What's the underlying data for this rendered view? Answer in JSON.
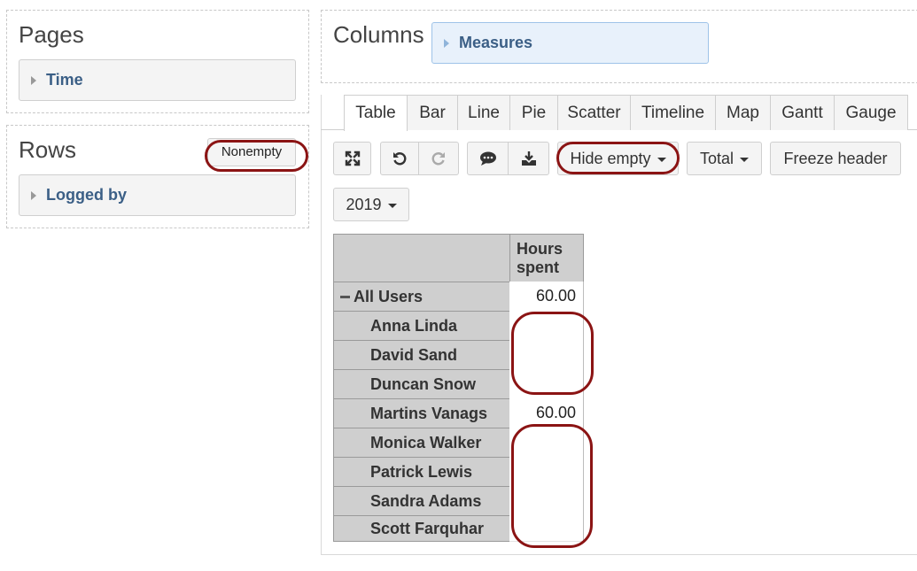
{
  "pages": {
    "title": "Pages",
    "dimension": "Time"
  },
  "rows": {
    "title": "Rows",
    "nonempty_label": "Nonempty",
    "dimension": "Logged by"
  },
  "columns": {
    "title": "Columns",
    "dimension": "Measures"
  },
  "tabs": [
    "Table",
    "Bar",
    "Line",
    "Pie",
    "Scatter",
    "Timeline",
    "Map",
    "Gantt",
    "Gauge"
  ],
  "active_tab": "Table",
  "toolbar": {
    "hide_empty_label": "Hide empty",
    "total_label": "Total",
    "freeze_header_label": "Freeze header",
    "year_label": "2019"
  },
  "table": {
    "column_header": [
      "Hours",
      "spent"
    ],
    "root": {
      "label": "All Users",
      "value": "60.00"
    },
    "rows": [
      {
        "label": "Anna Linda",
        "value": ""
      },
      {
        "label": "David Sand",
        "value": ""
      },
      {
        "label": "Duncan Snow",
        "value": ""
      },
      {
        "label": "Martins Vanags",
        "value": "60.00"
      },
      {
        "label": "Monica Walker",
        "value": ""
      },
      {
        "label": "Patrick Lewis",
        "value": ""
      },
      {
        "label": "Sandra Adams",
        "value": ""
      },
      {
        "label": "Scott Farquhar",
        "value": ""
      }
    ]
  },
  "highlight_color": "#8b1414"
}
